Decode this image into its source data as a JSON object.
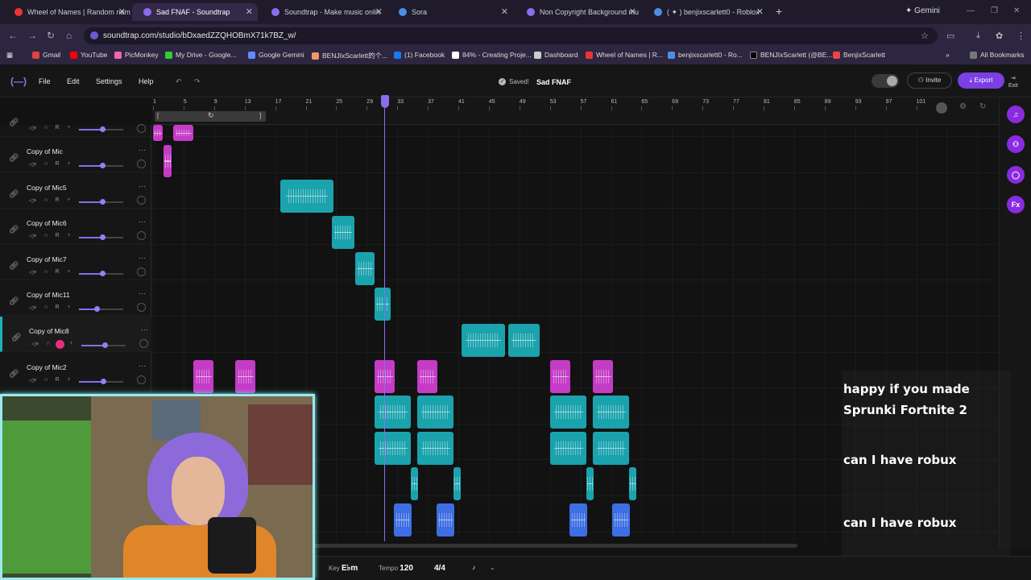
{
  "browser": {
    "tabs": [
      {
        "title": "Wheel of Names | Random nam",
        "color": "#ffffff"
      },
      {
        "title": "Sad FNAF - Soundtrap",
        "color": "#8b6cf0"
      },
      {
        "title": "Soundtrap - Make music onlin",
        "color": "#8b6cf0"
      },
      {
        "title": "Sora",
        "color": "#4a90e2"
      },
      {
        "title": "Non Copyright Background mu",
        "color": "#8b6cf0"
      },
      {
        "title": "( ✦ ) benjixscarlett0 - Roblox",
        "color": "#4a90e2"
      }
    ],
    "new_tab": "+",
    "gemini_label": "Gemini",
    "url": "soundtrap.com/studio/bDxaedZZQHOBmX71k7BZ_w/",
    "bookmarks": [
      "Gmail",
      "YouTube",
      "PicMonkey",
      "My Drive - Google...",
      "Google Gemini",
      "BENJIxScarlett的个...",
      "(1) Facebook",
      "84% - Creating Proje...",
      "Dashboard",
      "Wheel of Names | R...",
      "benjixscarlett0 - Ro...",
      "BENJIxScarlett (@BE...",
      "BenjixScarlett"
    ],
    "all_bookmarks": "All Bookmarks"
  },
  "studio": {
    "menu": {
      "file": "File",
      "edit": "Edit",
      "settings": "Settings",
      "help": "Help"
    },
    "saved": "Saved!",
    "project_title": "Sad FNAF",
    "invite": "Invite",
    "export": "Export",
    "exit": "Exit"
  },
  "ruler": [
    "1",
    "5",
    "9",
    "13",
    "17",
    "21",
    "25",
    "29",
    "33",
    "37",
    "41",
    "45",
    "49",
    "53",
    "57",
    "61",
    "65",
    "69",
    "73",
    "77",
    "81",
    "85",
    "89",
    "93",
    "97",
    "101"
  ],
  "tracks": [
    {
      "name": "Copy of Mic"
    },
    {
      "name": "Copy of Mic5"
    },
    {
      "name": "Copy of Mic6"
    },
    {
      "name": "Copy of Mic7"
    },
    {
      "name": "Copy of Mic11"
    },
    {
      "name": "Copy of Mic8"
    },
    {
      "name": "Copy of Mic2"
    }
  ],
  "track_controls": {
    "r": "R",
    "dots": "···"
  },
  "bottom": {
    "key_label": "Key",
    "key_value": "E♭m",
    "tempo_label": "Tempo",
    "tempo_value": "120",
    "time_sig": "4/4"
  },
  "chat": [
    {
      "user": "",
      "message": "happy if you made Sprunki Fortnite 2"
    },
    {
      "user": "",
      "message": "can I have robux"
    },
    {
      "user": "",
      "message": "can I have robux"
    }
  ]
}
